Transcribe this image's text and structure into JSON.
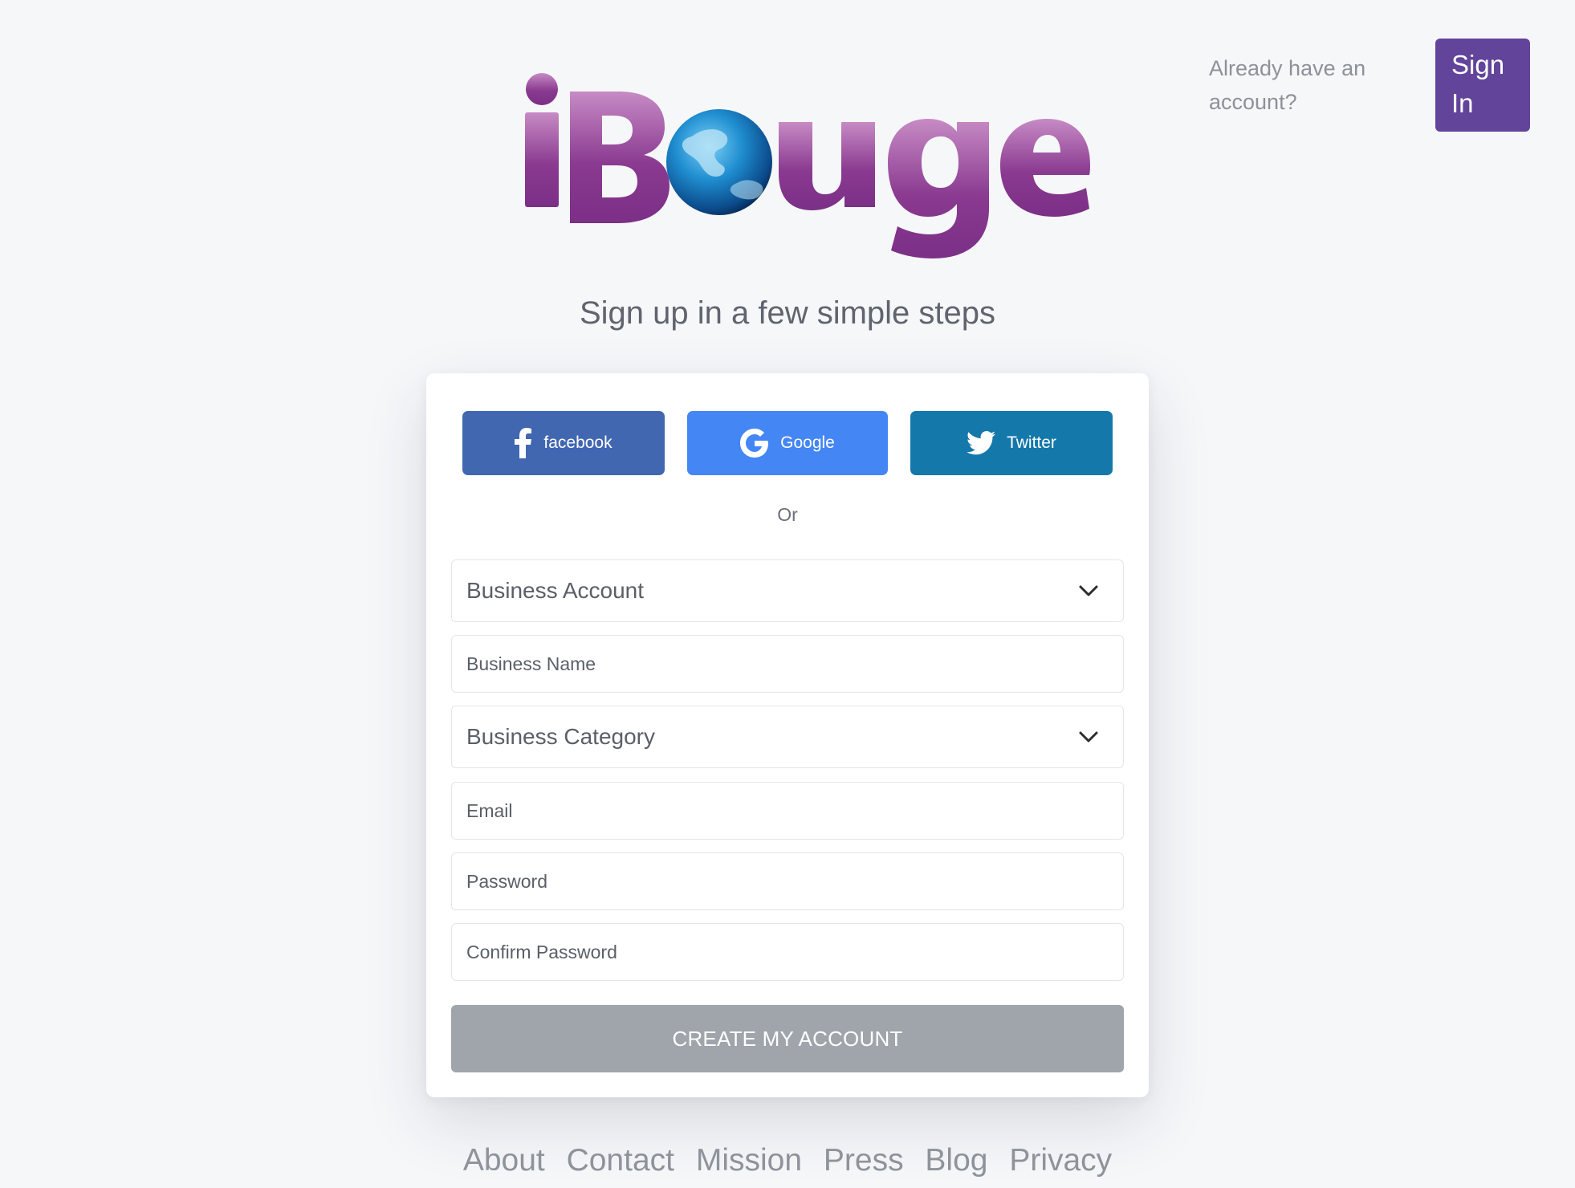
{
  "header": {
    "logo_text": "iBouge",
    "already_text": "Already have an account?",
    "signin_label": "Sign In"
  },
  "headline": "Sign up in a few simple steps",
  "social": {
    "facebook": "facebook",
    "google": "Google",
    "twitter": "Twitter"
  },
  "or_text": "Or",
  "form": {
    "account_type": "Business Account",
    "business_name_placeholder": "Business Name",
    "business_category": "Business Category",
    "email_placeholder": "Email",
    "password_placeholder": "Password",
    "confirm_password_placeholder": "Confirm Password",
    "submit_label": "CREATE MY ACCOUNT"
  },
  "footer": {
    "links": [
      "About",
      "Contact",
      "Mission",
      "Press",
      "Blog",
      "Privacy"
    ]
  },
  "colors": {
    "brand_purple": "#8a3a90",
    "signin_purple": "#62449b",
    "facebook_blue": "#4167b1",
    "google_blue": "#4486f4",
    "twitter_blue": "#1478ab",
    "submit_gray": "#a0a5ac"
  },
  "icons": {
    "globe": "globe-icon",
    "facebook": "facebook-icon",
    "google": "google-icon",
    "twitter": "twitter-icon",
    "chevron": "chevron-down-icon"
  }
}
